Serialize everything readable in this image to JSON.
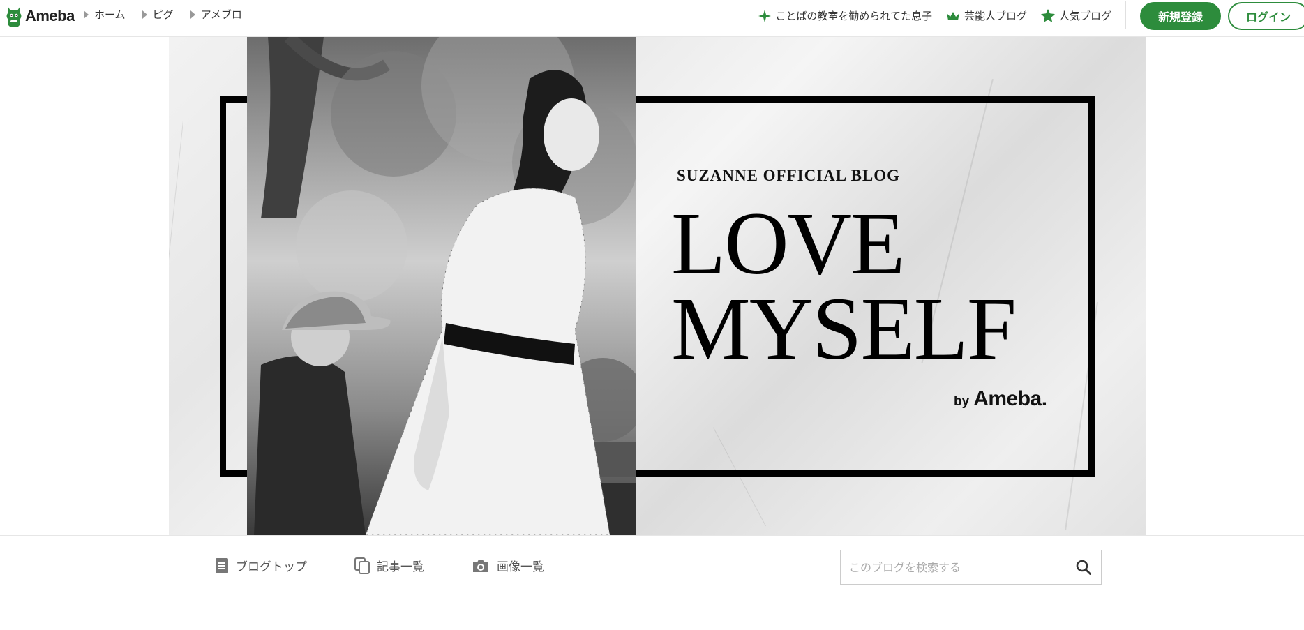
{
  "header": {
    "logo_text": "Ameba",
    "breadcrumbs": [
      {
        "label": "ホーム"
      },
      {
        "label": "ピグ"
      },
      {
        "label": "アメブロ"
      }
    ],
    "links": [
      {
        "label": "ことばの教室を勧められてた息子",
        "icon": "sparkle-icon"
      },
      {
        "label": "芸能人ブログ",
        "icon": "crown-icon"
      },
      {
        "label": "人気ブログ",
        "icon": "star-icon"
      }
    ],
    "signup_label": "新規登録",
    "login_label": "ログイン"
  },
  "hero": {
    "subtitle": "SUZANNE OFFICIAL BLOG",
    "title_line1": "LOVE",
    "title_line2": "MYSELF",
    "by": "by",
    "brand": "Ameba."
  },
  "blog_nav": {
    "items": [
      {
        "label": "ブログトップ",
        "icon": "document-icon"
      },
      {
        "label": "記事一覧",
        "icon": "copy-icon"
      },
      {
        "label": "画像一覧",
        "icon": "camera-icon"
      }
    ],
    "search_placeholder": "このブログを検索する"
  },
  "colors": {
    "accent": "#2d8c3c",
    "nav_text": "#555555"
  }
}
